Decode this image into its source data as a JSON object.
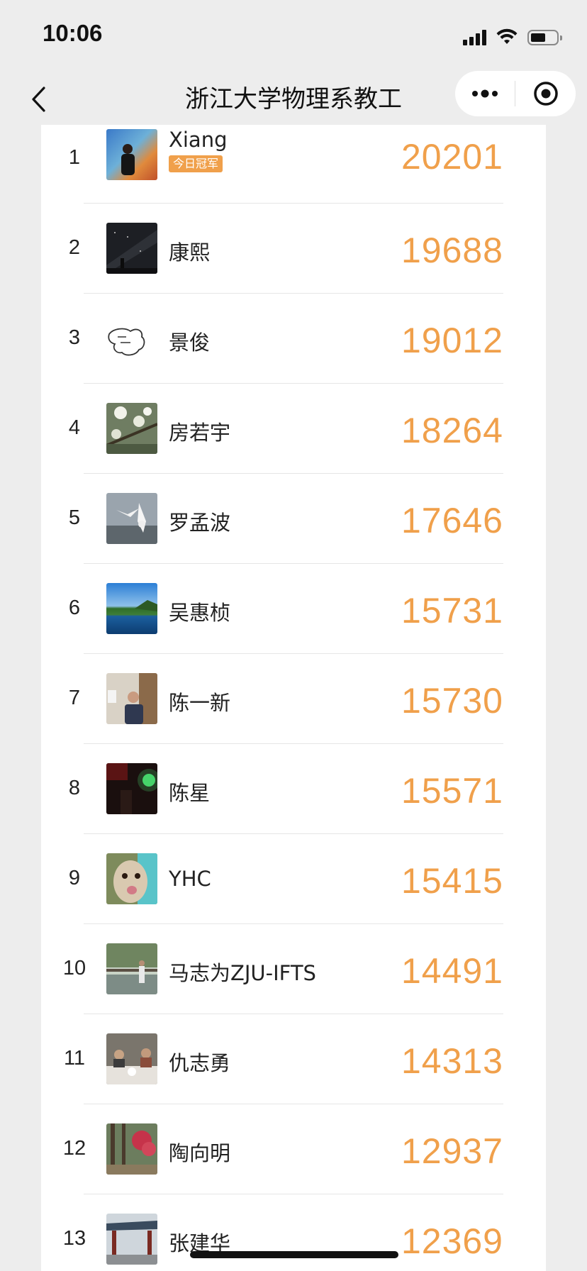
{
  "status_bar": {
    "time": "10:06",
    "icons": [
      "signal-icon",
      "wifi-icon",
      "battery-icon"
    ]
  },
  "nav": {
    "title": "浙江大学物理系教工",
    "back_icon": "chevron-left-icon",
    "more_icon": "more-dots-icon",
    "close_icon": "target-close-icon"
  },
  "colors": {
    "accent": "#f0a04b",
    "background": "#ededed",
    "card": "#ffffff"
  },
  "ranking": [
    {
      "rank": "1",
      "name": "Xiang",
      "badge": "今日冠军",
      "steps": "20201",
      "avatar": "portrait-hotspring"
    },
    {
      "rank": "2",
      "name": "康熙",
      "steps": "19688",
      "avatar": "night-sky-milkyway"
    },
    {
      "rank": "3",
      "name": "景俊",
      "steps": "19012",
      "avatar": "hand-sketch"
    },
    {
      "rank": "4",
      "name": "房若宇",
      "steps": "18264",
      "avatar": "blossom-branch"
    },
    {
      "rank": "5",
      "name": "罗孟波",
      "steps": "17646",
      "avatar": "seagulls"
    },
    {
      "rank": "6",
      "name": "吴惠桢",
      "steps": "15731",
      "avatar": "lake-landscape"
    },
    {
      "rank": "7",
      "name": "陈一新",
      "steps": "15730",
      "avatar": "man-indoors"
    },
    {
      "rank": "8",
      "name": "陈星",
      "steps": "15571",
      "avatar": "dark-green-light"
    },
    {
      "rank": "9",
      "name": "YHC",
      "steps": "15415",
      "avatar": "alpaca-face"
    },
    {
      "rank": "10",
      "name": "马志为ZJU-IFTS",
      "steps": "14491",
      "avatar": "man-by-pond"
    },
    {
      "rank": "11",
      "name": "仇志勇",
      "steps": "14313",
      "avatar": "dinner-group"
    },
    {
      "rank": "12",
      "name": "陶向明",
      "steps": "12937",
      "avatar": "red-autumn-tree"
    },
    {
      "rank": "13",
      "name": "张建华",
      "steps": "12369",
      "avatar": "pavilion-gate"
    }
  ]
}
